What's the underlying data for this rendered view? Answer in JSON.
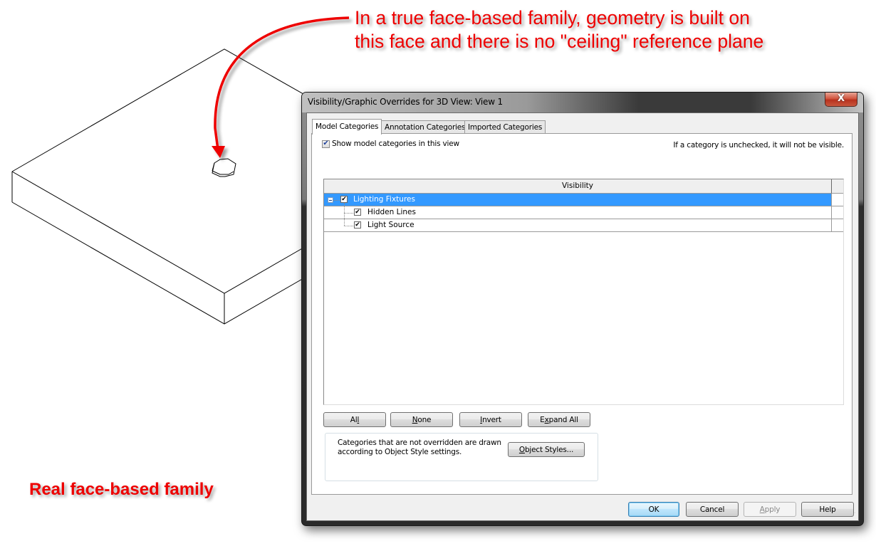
{
  "annotation": {
    "callout_lines": [
      "In a true face-based family, geometry is built on",
      "this face and there is no \"ceiling\" reference plane"
    ],
    "caption": "Real face-based family",
    "color": "#ee0000"
  },
  "dialog": {
    "title": "Visibility/Graphic Overrides for 3D View: View 1",
    "close_glyph": "X",
    "tabs": [
      {
        "label": "Model Categories",
        "active": true
      },
      {
        "label": "Annotation Categories",
        "active": false
      },
      {
        "label": "Imported Categories",
        "active": false
      }
    ],
    "show_checkbox": {
      "label": "Show model categories in this view",
      "checked": true
    },
    "hint": "If a category is unchecked, it will not be visible.",
    "grid": {
      "columns": [
        "Visibility"
      ],
      "rows": [
        {
          "label": "Lighting Fixtures",
          "checked": true,
          "level": 0,
          "expanded": true,
          "selected": true
        },
        {
          "label": "Hidden Lines",
          "checked": true,
          "level": 1,
          "selected": false
        },
        {
          "label": "Light Source",
          "checked": true,
          "level": 1,
          "selected": false
        }
      ]
    },
    "buttons": {
      "all": {
        "pre": "Al",
        "key": "l",
        "post": ""
      },
      "none": {
        "pre": "",
        "key": "N",
        "post": "one"
      },
      "invert": {
        "pre": "",
        "key": "I",
        "post": "nvert"
      },
      "expand": {
        "pre": "E",
        "key": "x",
        "post": "pand All"
      }
    },
    "styles_note": "Categories that are not overridden are drawn according to Object Style settings.",
    "object_styles": {
      "pre": "",
      "key": "O",
      "post": "bject Styles..."
    },
    "footer": {
      "ok": "OK",
      "cancel": "Cancel",
      "apply": {
        "pre": "",
        "key": "A",
        "post": "pply",
        "enabled": false
      },
      "help": "Help"
    },
    "selection_color": "#3399ff"
  }
}
